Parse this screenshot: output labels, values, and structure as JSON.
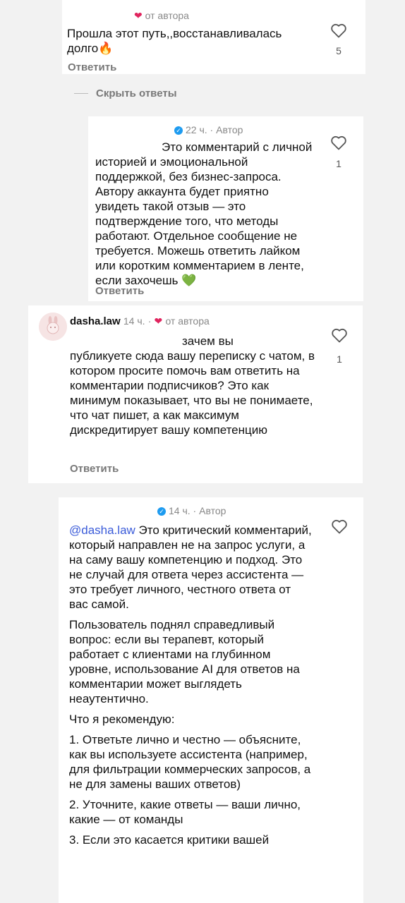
{
  "comment1": {
    "heart": "❤",
    "author_tag": "от автора",
    "text": "Прошла этот путь,,восстанавливалась долго🔥",
    "likes": "5",
    "reply_label": "Ответить"
  },
  "hide_replies_label": "Скрыть ответы",
  "reply1": {
    "time": "22 ч.",
    "dot": "·",
    "author_label": "Автор",
    "text": "Это комментарий с личной историей и эмоциональной поддержкой, без бизнес-запроса. Автору аккаунта будет приятно увидеть такой отзыв — это подтверждение того, что методы работают. Отдельное сообщение не требуется. Можешь ответить лайком или коротким комментарием в ленте, если захочешь 💚",
    "likes": "1",
    "reply_label": "Ответить"
  },
  "comment2": {
    "username": "dasha.law",
    "time": "14 ч.",
    "dot": "·",
    "heart": "❤",
    "author_tag": "от автора",
    "text_first": "зачем вы",
    "text": "публикуете сюда вашу переписку с чатом, в котором просите помочь вам ответить на комментарии подписчиков? Это как минимум показывает, что вы не понимаете, что чат пишет, а как максимум дискредитирует вашу компетенцию",
    "likes": "1",
    "reply_label": "Ответить"
  },
  "reply2": {
    "time": "14 ч.",
    "dot": "·",
    "author_label": "Автор",
    "mention": "@dasha.law",
    "p1": "Это критический комментарий, который направлен не на запрос услуги, а на саму вашу компетенцию и подход. Это не случай для ответа через ассистента — это требует личного, честного ответа от вас самой.",
    "p2": "Пользователь поднял справедливый вопрос: если вы терапевт, который работает с клиентами на глубинном уровне, использование AI для ответов на комментарии может выглядеть неаутентично.",
    "p3": "Что я рекомендую:",
    "p4": "1. Ответьте лично и честно — объясните, как вы используете ассистента (например, для фильтрации коммерческих запросов, а не для замены ваших ответов)",
    "p5": "2. Уточните, какие ответы — ваши лично, какие — от команды",
    "p6": "3. Если это касается критики вашей"
  }
}
